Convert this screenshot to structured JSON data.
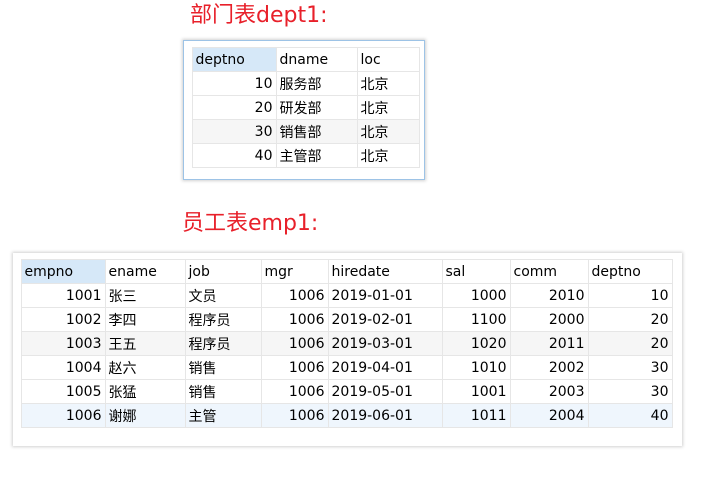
{
  "dept_caption": "部门表dept1:",
  "emp_caption": "员工表emp1:",
  "dept": {
    "columns": [
      "deptno",
      "dname",
      "loc"
    ],
    "rows": [
      [
        "10",
        "服务部",
        "北京"
      ],
      [
        "20",
        "研发部",
        "北京"
      ],
      [
        "30",
        "销售部",
        "北京"
      ],
      [
        "40",
        "主管部",
        "北京"
      ]
    ]
  },
  "emp": {
    "columns": [
      "empno",
      "ename",
      "job",
      "mgr",
      "hiredate",
      "sal",
      "comm",
      "deptno"
    ],
    "rows": [
      [
        "1001",
        "张三",
        "文员",
        "1006",
        "2019-01-01",
        "1000",
        "2010",
        "10"
      ],
      [
        "1002",
        "李四",
        "程序员",
        "1006",
        "2019-02-01",
        "1100",
        "2000",
        "20"
      ],
      [
        "1003",
        "王五",
        "程序员",
        "1006",
        "2019-03-01",
        "1020",
        "2011",
        "20"
      ],
      [
        "1004",
        "赵六",
        "销售",
        "1006",
        "2019-04-01",
        "1010",
        "2002",
        "30"
      ],
      [
        "1005",
        "张猛",
        "销售",
        "1006",
        "2019-05-01",
        "1001",
        "2003",
        "30"
      ],
      [
        "1006",
        "谢娜",
        "主管",
        "1006",
        "2019-06-01",
        "1011",
        "2004",
        "40"
      ]
    ]
  },
  "colors": {
    "caption": "#e8202a",
    "sorted_header": "#d6e8f8",
    "selected_row": "#eff6fd"
  }
}
